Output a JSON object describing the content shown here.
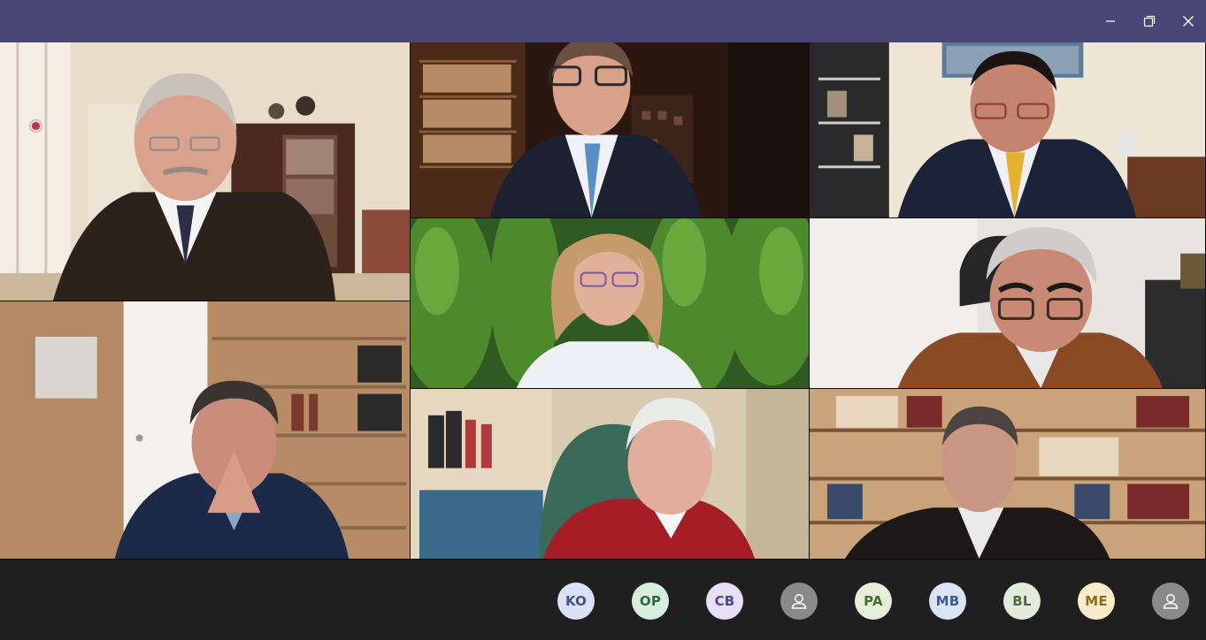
{
  "window": {
    "controls": [
      {
        "name": "minimize-icon"
      },
      {
        "name": "restore-icon"
      },
      {
        "name": "close-icon"
      }
    ]
  },
  "roster": {
    "participants": [
      {
        "initials": "KO",
        "bg": "#dbe2f8",
        "fg": "#3f4f8f"
      },
      {
        "initials": "OP",
        "bg": "#d6f0dd",
        "fg": "#2f6b3f"
      },
      {
        "initials": "CB",
        "bg": "#e6e0f6",
        "fg": "#4d4590"
      },
      {
        "initials": "",
        "icon": "person-icon",
        "bg": "#8a8a8a",
        "fg": "#ffffff"
      },
      {
        "initials": "PA",
        "bg": "#e3efd9",
        "fg": "#4b6a2e"
      },
      {
        "initials": "MB",
        "bg": "#d9e4f7",
        "fg": "#3b5a92"
      },
      {
        "initials": "BL",
        "bg": "#e3ecdc",
        "fg": "#52693f"
      },
      {
        "initials": "ME",
        "bg": "#fbecc9",
        "fg": "#8a6a1f"
      },
      {
        "initials": "",
        "icon": "person-icon",
        "bg": "#8a8a8a",
        "fg": "#ffffff"
      }
    ]
  },
  "colors": {
    "titlebar": "#464775",
    "background": "#1f1f1f",
    "recording": "#c4314b"
  }
}
